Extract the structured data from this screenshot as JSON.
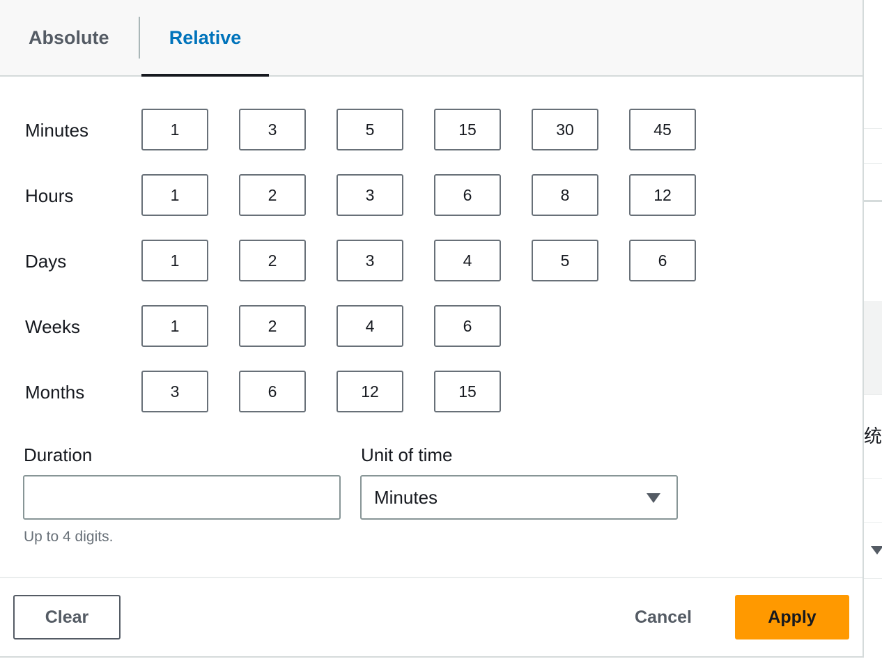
{
  "tabs": [
    {
      "label": "Absolute",
      "active": false
    },
    {
      "label": "Relative",
      "active": true
    }
  ],
  "relative_options": {
    "minutes": {
      "label": "Minutes",
      "values": [
        "1",
        "3",
        "5",
        "15",
        "30",
        "45"
      ]
    },
    "hours": {
      "label": "Hours",
      "values": [
        "1",
        "2",
        "3",
        "6",
        "8",
        "12"
      ]
    },
    "days": {
      "label": "Days",
      "values": [
        "1",
        "2",
        "3",
        "4",
        "5",
        "6"
      ]
    },
    "weeks": {
      "label": "Weeks",
      "values": [
        "1",
        "2",
        "4",
        "6"
      ]
    },
    "months": {
      "label": "Months",
      "values": [
        "3",
        "6",
        "12",
        "15"
      ]
    }
  },
  "duration": {
    "label": "Duration",
    "value": "",
    "placeholder": "",
    "hint": "Up to 4 digits."
  },
  "unit": {
    "label": "Unit of time",
    "selected": "Minutes",
    "icon": "caret-down-icon"
  },
  "footer": {
    "clear_label": "Clear",
    "cancel_label": "Cancel",
    "apply_label": "Apply"
  },
  "background": {
    "partial_text": "统计"
  },
  "colors": {
    "accent": "#0073bb",
    "primary_button": "#ff9900",
    "text": "#16191f",
    "muted": "#687078"
  }
}
